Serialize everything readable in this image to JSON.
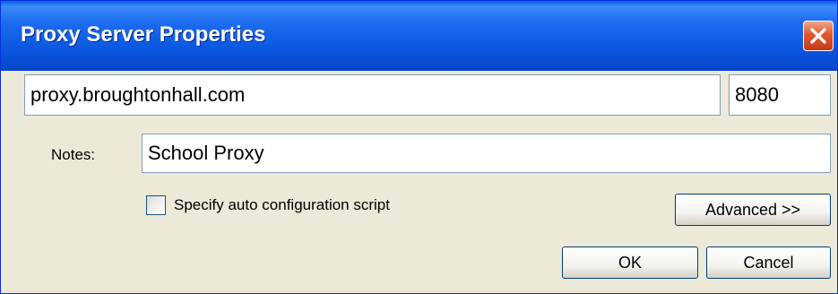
{
  "window": {
    "title": "Proxy Server Properties",
    "close_icon": "close-icon"
  },
  "proxy": {
    "address": "proxy.broughtonhall.com",
    "port": "8080"
  },
  "notes": {
    "label": "Notes:",
    "value": "School Proxy"
  },
  "auto_config": {
    "label": "Specify auto configuration script",
    "checked": false
  },
  "buttons": {
    "advanced": "Advanced >>",
    "ok": "OK",
    "cancel": "Cancel"
  },
  "colors": {
    "titlebar": "#0a56e0",
    "close_button": "#e0582f",
    "dialog_background": "#ece9d8",
    "field_border": "#7f9db9"
  }
}
